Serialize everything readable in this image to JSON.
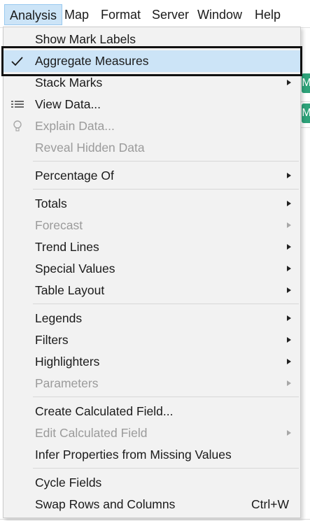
{
  "menubar": {
    "items": [
      {
        "label": "Analysis",
        "active": true
      },
      {
        "label": "Map"
      },
      {
        "label": "Format"
      },
      {
        "label": "Server"
      },
      {
        "label": "Window"
      },
      {
        "label": "Help"
      }
    ]
  },
  "background": {
    "pills": [
      "M",
      "M"
    ]
  },
  "menu": {
    "groups": [
      {
        "items": [
          {
            "label": "Show Mark Labels"
          },
          {
            "label": "Aggregate Measures",
            "checked": true,
            "icon": "check-icon"
          },
          {
            "label": "Stack Marks",
            "submenu": true
          },
          {
            "label": "View Data...",
            "icon": "table-icon"
          },
          {
            "label": "Explain Data...",
            "disabled": true,
            "icon": "lightbulb-icon"
          },
          {
            "label": "Reveal Hidden Data",
            "disabled": true
          }
        ]
      },
      {
        "items": [
          {
            "label": "Percentage Of",
            "submenu": true
          }
        ]
      },
      {
        "items": [
          {
            "label": "Totals",
            "submenu": true
          },
          {
            "label": "Forecast",
            "submenu": true,
            "disabled": true
          },
          {
            "label": "Trend Lines",
            "submenu": true
          },
          {
            "label": "Special Values",
            "submenu": true
          },
          {
            "label": "Table Layout",
            "submenu": true
          }
        ]
      },
      {
        "items": [
          {
            "label": "Legends",
            "submenu": true
          },
          {
            "label": "Filters",
            "submenu": true
          },
          {
            "label": "Highlighters",
            "submenu": true
          },
          {
            "label": "Parameters",
            "submenu": true,
            "disabled": true
          }
        ]
      },
      {
        "items": [
          {
            "label": "Create Calculated Field..."
          },
          {
            "label": "Edit Calculated Field",
            "submenu": true,
            "disabled": true
          },
          {
            "label": "Infer Properties from Missing Values"
          }
        ]
      },
      {
        "items": [
          {
            "label": "Cycle Fields"
          },
          {
            "label": "Swap Rows and Columns",
            "accelerator": "Ctrl+W"
          }
        ]
      }
    ]
  },
  "colors": {
    "menu_bg": "#f2f2f2",
    "checked_bg": "#cce4f7",
    "active_menubar_bg": "#cce4f7",
    "disabled_text": "#9b9b9b",
    "pill_green": "#2ea37a"
  }
}
